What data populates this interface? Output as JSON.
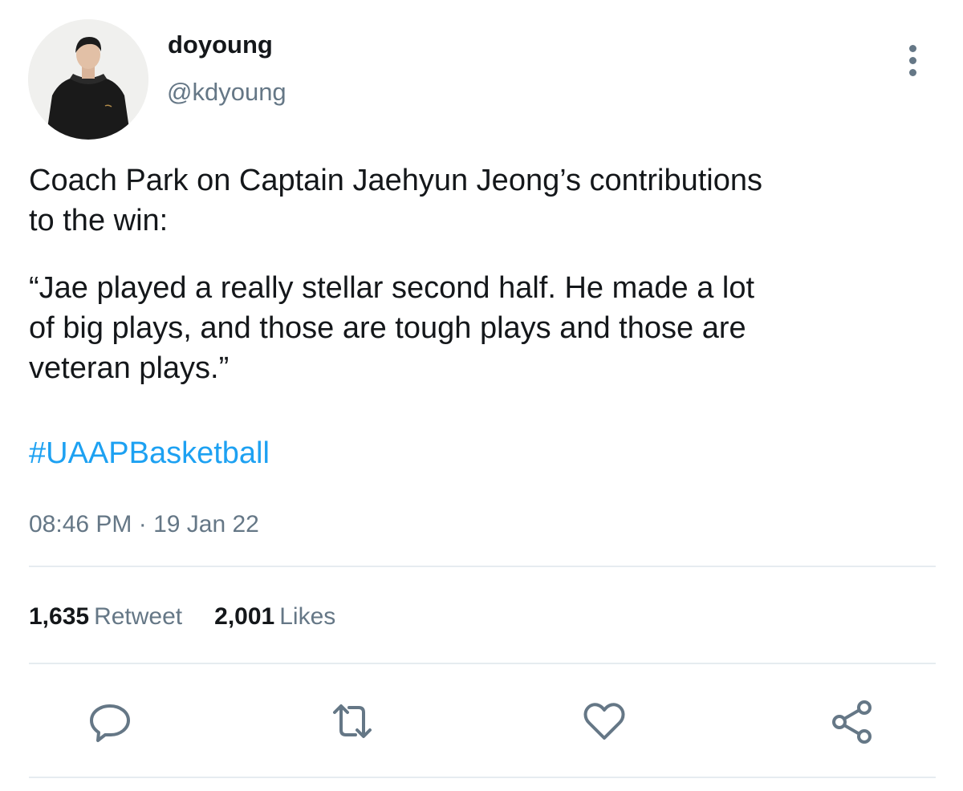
{
  "user": {
    "display_name": "doyoung",
    "handle": "@kdyoung"
  },
  "tweet": {
    "paragraphs": [
      "Coach Park on Captain Jaehyun Jeong’s contributions\nto the win:",
      "“Jae played a really stellar second half. He made a lot\nof big plays, and those are tough plays and those are\nveteran plays.”"
    ],
    "hashtag": "#UAAPBasketball",
    "timestamp": "08:46 PM · 19 Jan 22"
  },
  "stats": {
    "retweets_count": "1,635",
    "retweets_label": "Retweet",
    "likes_count": "2,001",
    "likes_label": "Likes"
  },
  "actions": [
    "reply-icon",
    "retweet-icon",
    "like-icon",
    "share-icon"
  ],
  "colors": {
    "text": "#14171a",
    "secondary": "#657786",
    "link": "#1da1f2",
    "divider": "#e6ecf0"
  }
}
